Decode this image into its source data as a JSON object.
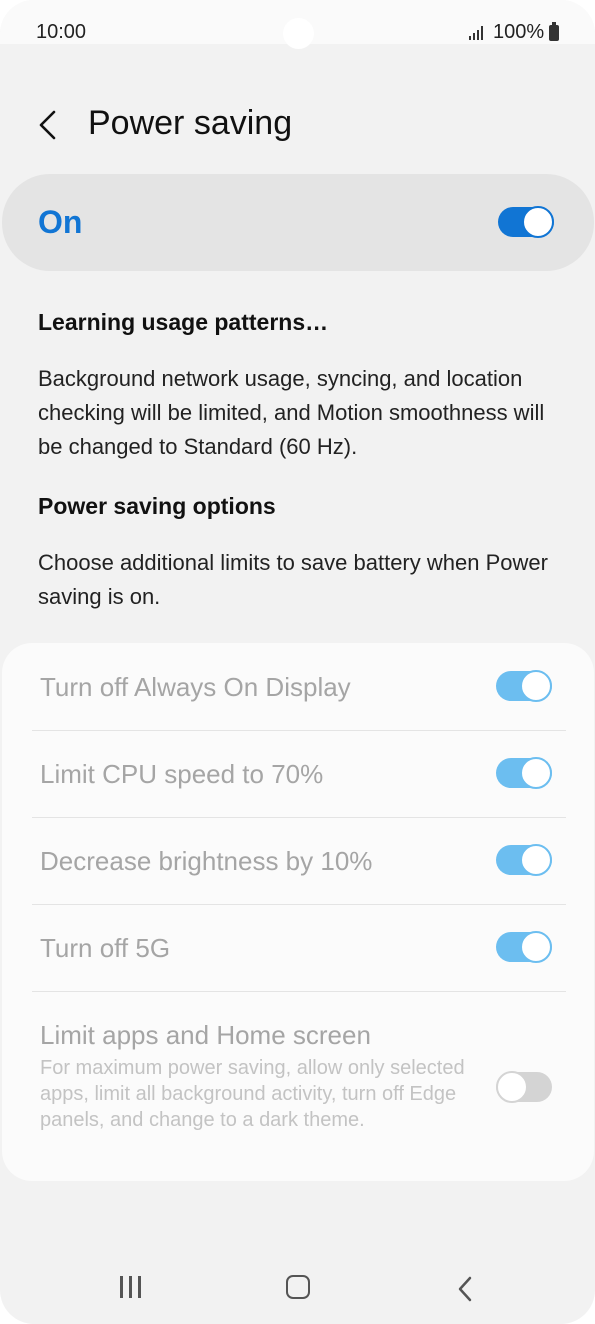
{
  "status_bar": {
    "time": "10:00",
    "battery": "100%"
  },
  "header": {
    "title": "Power saving"
  },
  "master": {
    "label": "On",
    "enabled": true
  },
  "learning": {
    "heading": "Learning usage patterns…",
    "body": "Background network usage, syncing, and location checking will be limited, and Motion smoothness will be changed to Standard (60 Hz)."
  },
  "options_intro": {
    "heading": "Power saving options",
    "body": "Choose additional limits to save battery when Power saving is on."
  },
  "options": [
    {
      "label": "Turn off Always On Display",
      "enabled": true
    },
    {
      "label": "Limit CPU speed to 70%",
      "enabled": true
    },
    {
      "label": "Decrease brightness by 10%",
      "enabled": true
    },
    {
      "label": "Turn off 5G",
      "enabled": true
    },
    {
      "label": "Limit apps and Home screen",
      "description": "For maximum power saving, allow only selected apps, limit all background activity, turn off Edge panels, and change to a dark theme.",
      "enabled": false
    }
  ],
  "colors": {
    "accent": "#1175d4",
    "toggle_on_disabled": "#6cbef0",
    "toggle_off": "#cfcfcf"
  },
  "icons": {
    "back": "chevron-left-icon",
    "nav_recents": "recents-icon",
    "nav_home": "home-icon",
    "nav_back": "back-icon"
  }
}
